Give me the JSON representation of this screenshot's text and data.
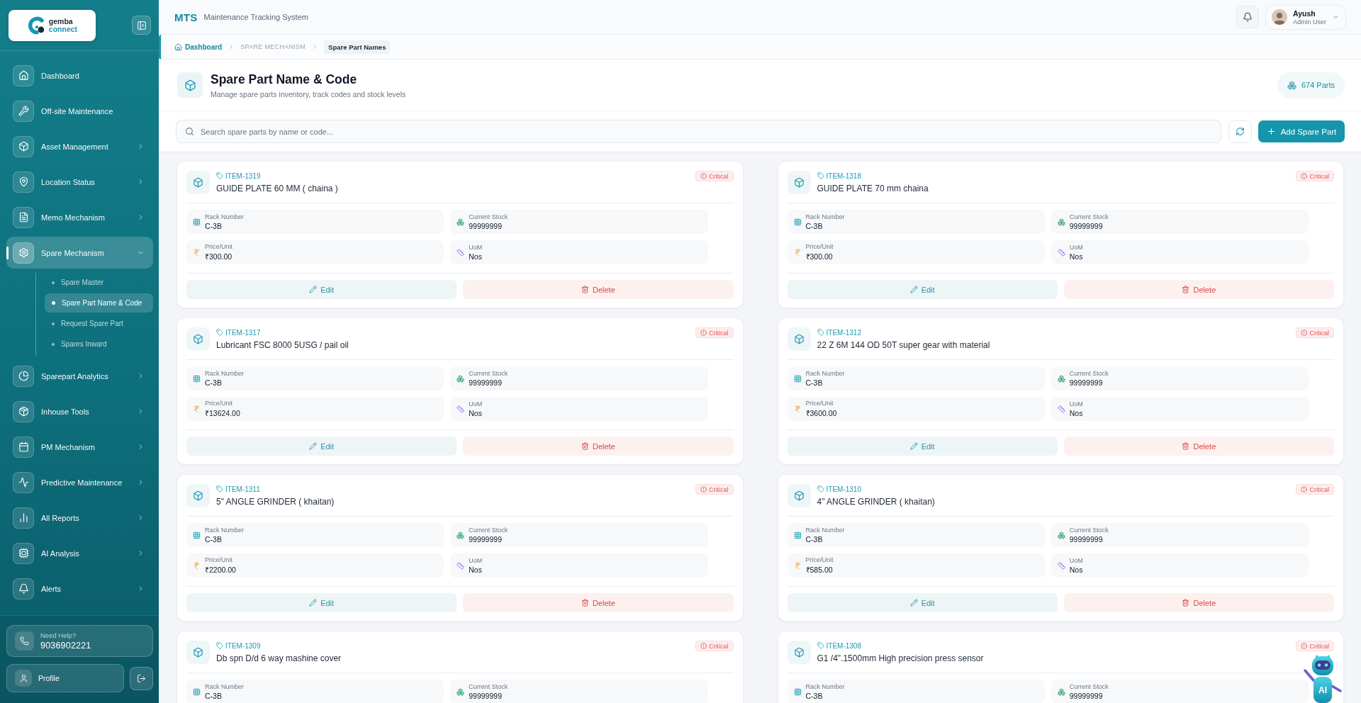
{
  "sidebar": {
    "logo": {
      "line1": "gemba",
      "line2": "connect"
    },
    "items": [
      {
        "label": "Dashboard",
        "expandable": false,
        "expanded": false,
        "selected": false
      },
      {
        "label": "Off-site Maintenance",
        "expandable": false,
        "expanded": false,
        "selected": false
      },
      {
        "label": "Asset Management",
        "expandable": true,
        "expanded": false,
        "selected": false
      },
      {
        "label": "Location Status",
        "expandable": true,
        "expanded": false,
        "selected": false
      },
      {
        "label": "Memo Mechanism",
        "expandable": true,
        "expanded": false,
        "selected": false
      },
      {
        "label": "Spare Mechanism",
        "expandable": true,
        "expanded": true,
        "selected": true,
        "children": [
          {
            "label": "Spare Master",
            "selected": false
          },
          {
            "label": "Spare Part Name & Code",
            "selected": true
          },
          {
            "label": "Request Spare Part",
            "selected": false
          },
          {
            "label": "Spares Inward",
            "selected": false
          }
        ]
      },
      {
        "label": "Sparepart Analytics",
        "expandable": true,
        "expanded": false,
        "selected": false
      },
      {
        "label": "Inhouse Tools",
        "expandable": true,
        "expanded": false,
        "selected": false
      },
      {
        "label": "PM Mechanism",
        "expandable": true,
        "expanded": false,
        "selected": false
      },
      {
        "label": "Predictive Maintenance",
        "expandable": true,
        "expanded": false,
        "selected": false
      },
      {
        "label": "All Reports",
        "expandable": true,
        "expanded": false,
        "selected": false
      },
      {
        "label": "AI Analysis",
        "expandable": true,
        "expanded": false,
        "selected": false
      },
      {
        "label": "Alerts",
        "expandable": true,
        "expanded": false,
        "selected": false
      }
    ],
    "help": {
      "label": "Need Help?",
      "phone": "9036902221"
    },
    "profile": "Profile"
  },
  "header": {
    "brand": "MTS",
    "subtitle": "Maintenance Tracking System",
    "user": {
      "name": "Ayush",
      "role": "Admin User"
    }
  },
  "breadcrumb": [
    {
      "kind": "link",
      "label": "Dashboard"
    },
    {
      "kind": "section",
      "label": "SPARE MECHANISM"
    },
    {
      "kind": "current",
      "label": "Spare Part Names"
    }
  ],
  "page": {
    "title": "Spare Part Name & Code",
    "subtitle": "Manage spare parts inventory, track codes and stock levels",
    "count": "674 Parts"
  },
  "toolbar": {
    "search_placeholder": "Search spare parts by name or code...",
    "add_button": "Add Spare Part"
  },
  "cards": [
    {
      "code": "ITEM-1319",
      "name": "GUIDE PLATE 60 MM ( chaina )",
      "status": "Critical",
      "fields": [
        {
          "label": "Rack Number",
          "value": "C-3B"
        },
        {
          "label": "Current Stock",
          "value": "99999999"
        },
        {
          "label": "Price/Unit",
          "value": "₹300.00"
        },
        {
          "label": "UoM",
          "value": "Nos"
        }
      ],
      "actions": [
        {
          "kind": "edit",
          "label": "Edit"
        },
        {
          "kind": "delete",
          "label": "Delete"
        }
      ]
    },
    {
      "code": "ITEM-1318",
      "name": "GUIDE PLATE 70 mm chaina",
      "status": "Critical",
      "fields": [
        {
          "label": "Rack Number",
          "value": "C-3B"
        },
        {
          "label": "Current Stock",
          "value": "99999999"
        },
        {
          "label": "Price/Unit",
          "value": "₹300.00"
        },
        {
          "label": "UoM",
          "value": "Nos"
        }
      ],
      "actions": [
        {
          "kind": "edit",
          "label": "Edit"
        },
        {
          "kind": "delete",
          "label": "Delete"
        }
      ]
    },
    {
      "code": "ITEM-1317",
      "name": "Lubricant FSC 8000 5USG / pail oil",
      "status": "Critical",
      "fields": [
        {
          "label": "Rack Number",
          "value": "C-3B"
        },
        {
          "label": "Current Stock",
          "value": "99999999"
        },
        {
          "label": "Price/Unit",
          "value": "₹13624.00"
        },
        {
          "label": "UoM",
          "value": "Nos"
        }
      ],
      "actions": [
        {
          "kind": "edit",
          "label": "Edit"
        },
        {
          "kind": "delete",
          "label": "Delete"
        }
      ]
    },
    {
      "code": "ITEM-1312",
      "name": "22 Z 6M 144 OD 50T super gear with material",
      "status": "Critical",
      "fields": [
        {
          "label": "Rack Number",
          "value": "C-3B"
        },
        {
          "label": "Current Stock",
          "value": "99999999"
        },
        {
          "label": "Price/Unit",
          "value": "₹3600.00"
        },
        {
          "label": "UoM",
          "value": "Nos"
        }
      ],
      "actions": [
        {
          "kind": "edit",
          "label": "Edit"
        },
        {
          "kind": "delete",
          "label": "Delete"
        }
      ]
    },
    {
      "code": "ITEM-1311",
      "name": "5\" ANGLE GRINDER ( khaitan)",
      "status": "Critical",
      "fields": [
        {
          "label": "Rack Number",
          "value": "C-3B"
        },
        {
          "label": "Current Stock",
          "value": "99999999"
        },
        {
          "label": "Price/Unit",
          "value": "₹2200.00"
        },
        {
          "label": "UoM",
          "value": "Nos"
        }
      ],
      "actions": [
        {
          "kind": "edit",
          "label": "Edit"
        },
        {
          "kind": "delete",
          "label": "Delete"
        }
      ]
    },
    {
      "code": "ITEM-1310",
      "name": "4\" ANGLE GRINDER ( khaitan)",
      "status": "Critical",
      "fields": [
        {
          "label": "Rack Number",
          "value": "C-3B"
        },
        {
          "label": "Current Stock",
          "value": "99999999"
        },
        {
          "label": "Price/Unit",
          "value": "₹585.00"
        },
        {
          "label": "UoM",
          "value": "Nos"
        }
      ],
      "actions": [
        {
          "kind": "edit",
          "label": "Edit"
        },
        {
          "kind": "delete",
          "label": "Delete"
        }
      ]
    },
    {
      "code": "ITEM-1309",
      "name": "Db spn D/d 6 way mashine cover",
      "status": "Critical",
      "fields": [
        {
          "label": "Rack Number",
          "value": "C-3B"
        },
        {
          "label": "Current Stock",
          "value": "99999999"
        }
      ]
    },
    {
      "code": "ITEM-1308",
      "name": "G1 /4\".1500mm High precision press sensor",
      "status": "Critical",
      "fields": [
        {
          "label": "Rack Number",
          "value": "C-3B"
        },
        {
          "label": "Current Stock",
          "value": "99999999"
        }
      ]
    }
  ],
  "assistant": {
    "label": "AI"
  }
}
